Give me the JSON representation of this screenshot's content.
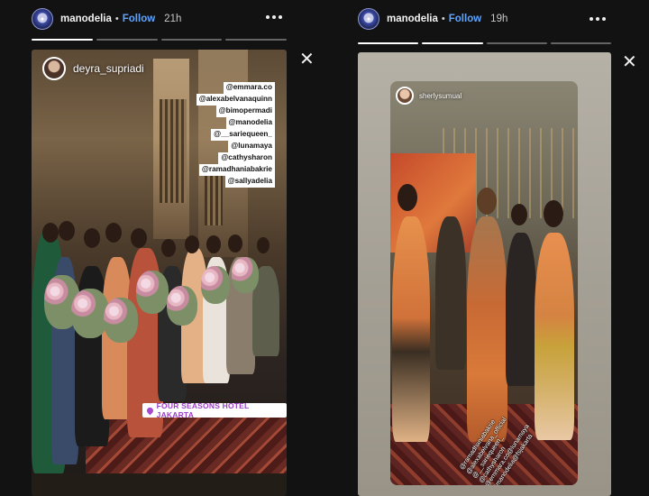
{
  "stories": [
    {
      "header": {
        "username": "manodelia",
        "separator": "•",
        "follow_label": "Follow",
        "time_ago": "21h"
      },
      "progress": [
        1,
        0,
        0,
        0
      ],
      "media": {
        "owner": "deyra_supriadi",
        "mentions": [
          "@emmara.co",
          "@alexabelvanaquinn",
          "@bimopermadi",
          "@manodelia",
          "@__sariequeen_",
          "@lunamaya",
          "@cathysharon",
          "@ramadhaniabakrie",
          "@sallyadelia"
        ],
        "location": "FOUR SEASONS HOTEL JAKARTA"
      }
    },
    {
      "header": {
        "username": "manodelia",
        "separator": "•",
        "follow_label": "Follow",
        "time_ago": "19h"
      },
      "progress": [
        1,
        1,
        0,
        0
      ],
      "media": {
        "owner": "sherlysumual",
        "mentions": [
          "@ramadhaniabakrie",
          "@alexabelvana_official",
          "@__sariequeen_",
          "@cathysharon",
          "@emmara.co@lunamaya",
          "@manodelia@fsjakarta"
        ]
      }
    }
  ],
  "icons": {
    "close": "close-icon",
    "more": "more-options-icon",
    "location": "location-pin-icon"
  },
  "colors": {
    "background": "#121212",
    "follow": "#5ea4ff",
    "location_text": "#9b3fc6"
  }
}
